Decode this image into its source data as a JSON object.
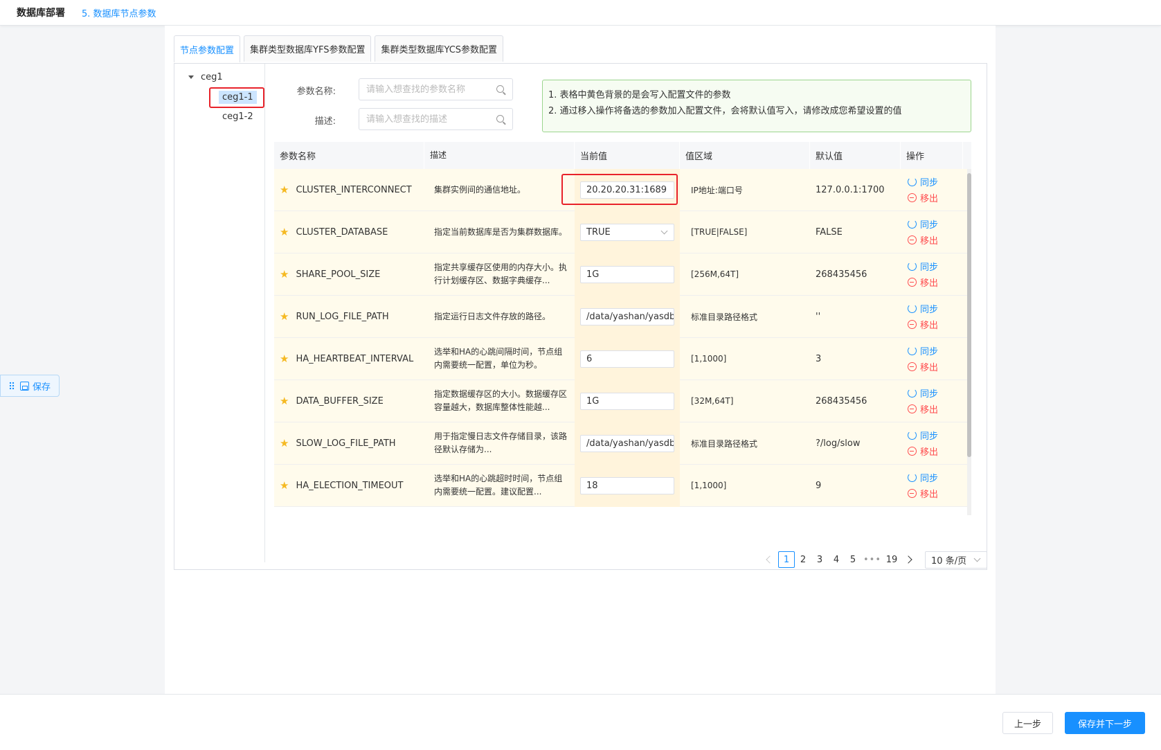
{
  "header": {
    "title": "数据库部署",
    "step": "5. 数据库节点参数"
  },
  "tabs": [
    {
      "label": "节点参数配置",
      "active": true
    },
    {
      "label": "集群类型数据库YFS参数配置",
      "active": false
    },
    {
      "label": "集群类型数据库YCS参数配置",
      "active": false
    }
  ],
  "tree": {
    "root": "ceg1",
    "nodes": [
      {
        "label": "ceg1-1",
        "selected": true
      },
      {
        "label": "ceg1-2",
        "selected": false
      }
    ]
  },
  "search": {
    "name_label": "参数名称:",
    "name_placeholder": "请输入想查找的参数名称",
    "desc_label": "描述:",
    "desc_placeholder": "请输入想查找的描述"
  },
  "notice": {
    "line1": "1. 表格中黄色背景的是会写入配置文件的参数",
    "line2": "2. 通过移入操作将备选的参数加入配置文件，会将默认值写入，请修改成您希望设置的值"
  },
  "table": {
    "columns": [
      "参数名称",
      "描述",
      "当前值",
      "值区域",
      "默认值",
      "操作"
    ],
    "sync_label": "同步",
    "remove_label": "移出",
    "rows": [
      {
        "name": "CLUSTER_INTERCONNECT",
        "desc": "集群实例间的通信地址。",
        "value": "20.20.20.31:1689",
        "range": "IP地址:端口号",
        "default": "127.0.0.1:1700",
        "select": false
      },
      {
        "name": "CLUSTER_DATABASE",
        "desc": "指定当前数据库是否为集群数据库。",
        "value": "TRUE",
        "range": "[TRUE|FALSE]",
        "default": "FALSE",
        "select": true
      },
      {
        "name": "SHARE_POOL_SIZE",
        "desc": "指定共享缓存区使用的内存大小。执行计划缓存区、数据字典缓存...",
        "value": "1G",
        "range": "[256M,64T]",
        "default": "268435456",
        "select": false
      },
      {
        "name": "RUN_LOG_FILE_PATH",
        "desc": "指定运行日志文件存放的路径。",
        "value": "/data/yashan/yasdb",
        "range": "标准目录路径格式",
        "default": "''",
        "select": false
      },
      {
        "name": "HA_HEARTBEAT_INTERVAL",
        "desc": "选举和HA的心跳间隔时间，节点组内需要统一配置，单位为秒。",
        "value": "6",
        "range": "[1,1000]",
        "default": "3",
        "select": false
      },
      {
        "name": "DATA_BUFFER_SIZE",
        "desc": "指定数据缓存区的大小。数据缓存区容量越大，数据库整体性能越...",
        "value": "1G",
        "range": "[32M,64T]",
        "default": "268435456",
        "select": false
      },
      {
        "name": "SLOW_LOG_FILE_PATH",
        "desc": "用于指定慢日志文件存储目录，该路径默认存储为...",
        "value": "/data/yashan/yasdb",
        "range": "标准目录路径格式",
        "default": "?/log/slow",
        "select": false
      },
      {
        "name": "HA_ELECTION_TIMEOUT",
        "desc": "选举和HA的心跳超时时间，节点组内需要统一配置。建议配置...",
        "value": "18",
        "range": "[1,1000]",
        "default": "9",
        "select": false
      }
    ]
  },
  "pagination": {
    "pages": [
      "1",
      "2",
      "3",
      "4",
      "5"
    ],
    "ellipsis": "•••",
    "last": "19",
    "current": "1",
    "page_size": "10 条/页"
  },
  "save_float": {
    "label": "保存"
  },
  "footer": {
    "prev_label": "上一步",
    "next_label": "保存并下一步"
  },
  "colors": {
    "accent": "#1890ff",
    "danger": "#ff4d4f",
    "row_bg": "#fffbec",
    "highlight": "#e8222a"
  }
}
